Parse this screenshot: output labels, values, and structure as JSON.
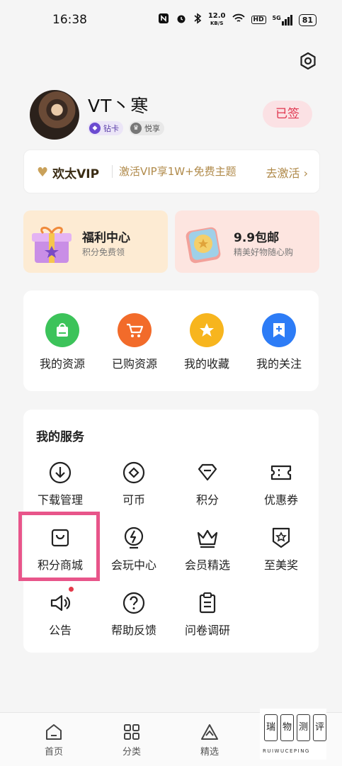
{
  "status_bar": {
    "time": "16:38",
    "net_speed_value": "12.0",
    "net_speed_unit": "KB/S",
    "hd": "HD",
    "signal": "5G",
    "battery": "81"
  },
  "profile": {
    "username": "VT丶寒",
    "badge_diamond": "钻卡",
    "badge_yue": "悦享",
    "signed_label": "已签"
  },
  "vip": {
    "brand": "欢太VIP",
    "description": "激活VIP享1W+免费主题",
    "action": "去激活"
  },
  "promo_cards": [
    {
      "title": "福利中心",
      "subtitle": "积分免费领"
    },
    {
      "title": "9.9包邮",
      "subtitle": "精美好物随心购"
    }
  ],
  "quick_actions": [
    {
      "label": "我的资源",
      "color": "#3cc35a",
      "icon": "bag-icon"
    },
    {
      "label": "已购资源",
      "color": "#f26b2a",
      "icon": "cart-icon"
    },
    {
      "label": "我的收藏",
      "color": "#f7b51e",
      "icon": "star-icon"
    },
    {
      "label": "我的关注",
      "color": "#2d7cf6",
      "icon": "plus-bookmark-icon"
    }
  ],
  "services": {
    "title": "我的服务",
    "items": [
      {
        "label": "下载管理",
        "icon": "download-icon"
      },
      {
        "label": "可币",
        "icon": "coin-icon"
      },
      {
        "label": "积分",
        "icon": "diamond-icon"
      },
      {
        "label": "优惠券",
        "icon": "ticket-icon"
      },
      {
        "label": "积分商城",
        "icon": "shopping-bag-icon"
      },
      {
        "label": "会玩中心",
        "icon": "lightning-icon"
      },
      {
        "label": "会员精选",
        "icon": "crown-icon"
      },
      {
        "label": "至美奖",
        "icon": "award-icon"
      },
      {
        "label": "公告",
        "icon": "speaker-icon"
      },
      {
        "label": "帮助反馈",
        "icon": "help-icon"
      },
      {
        "label": "问卷调研",
        "icon": "clipboard-icon"
      }
    ]
  },
  "bottom_nav": [
    {
      "label": "首页",
      "icon": "home-icon"
    },
    {
      "label": "分类",
      "icon": "grid-icon"
    },
    {
      "label": "精选",
      "icon": "triangle-icon"
    }
  ],
  "watermark": {
    "chars": [
      "瑞",
      "物",
      "测",
      "评"
    ],
    "latin": "RUIWUCEPING"
  },
  "colors": {
    "highlight": "#e8558a",
    "signed_text": "#e0354e",
    "vip_gold": "#b08a4a"
  }
}
